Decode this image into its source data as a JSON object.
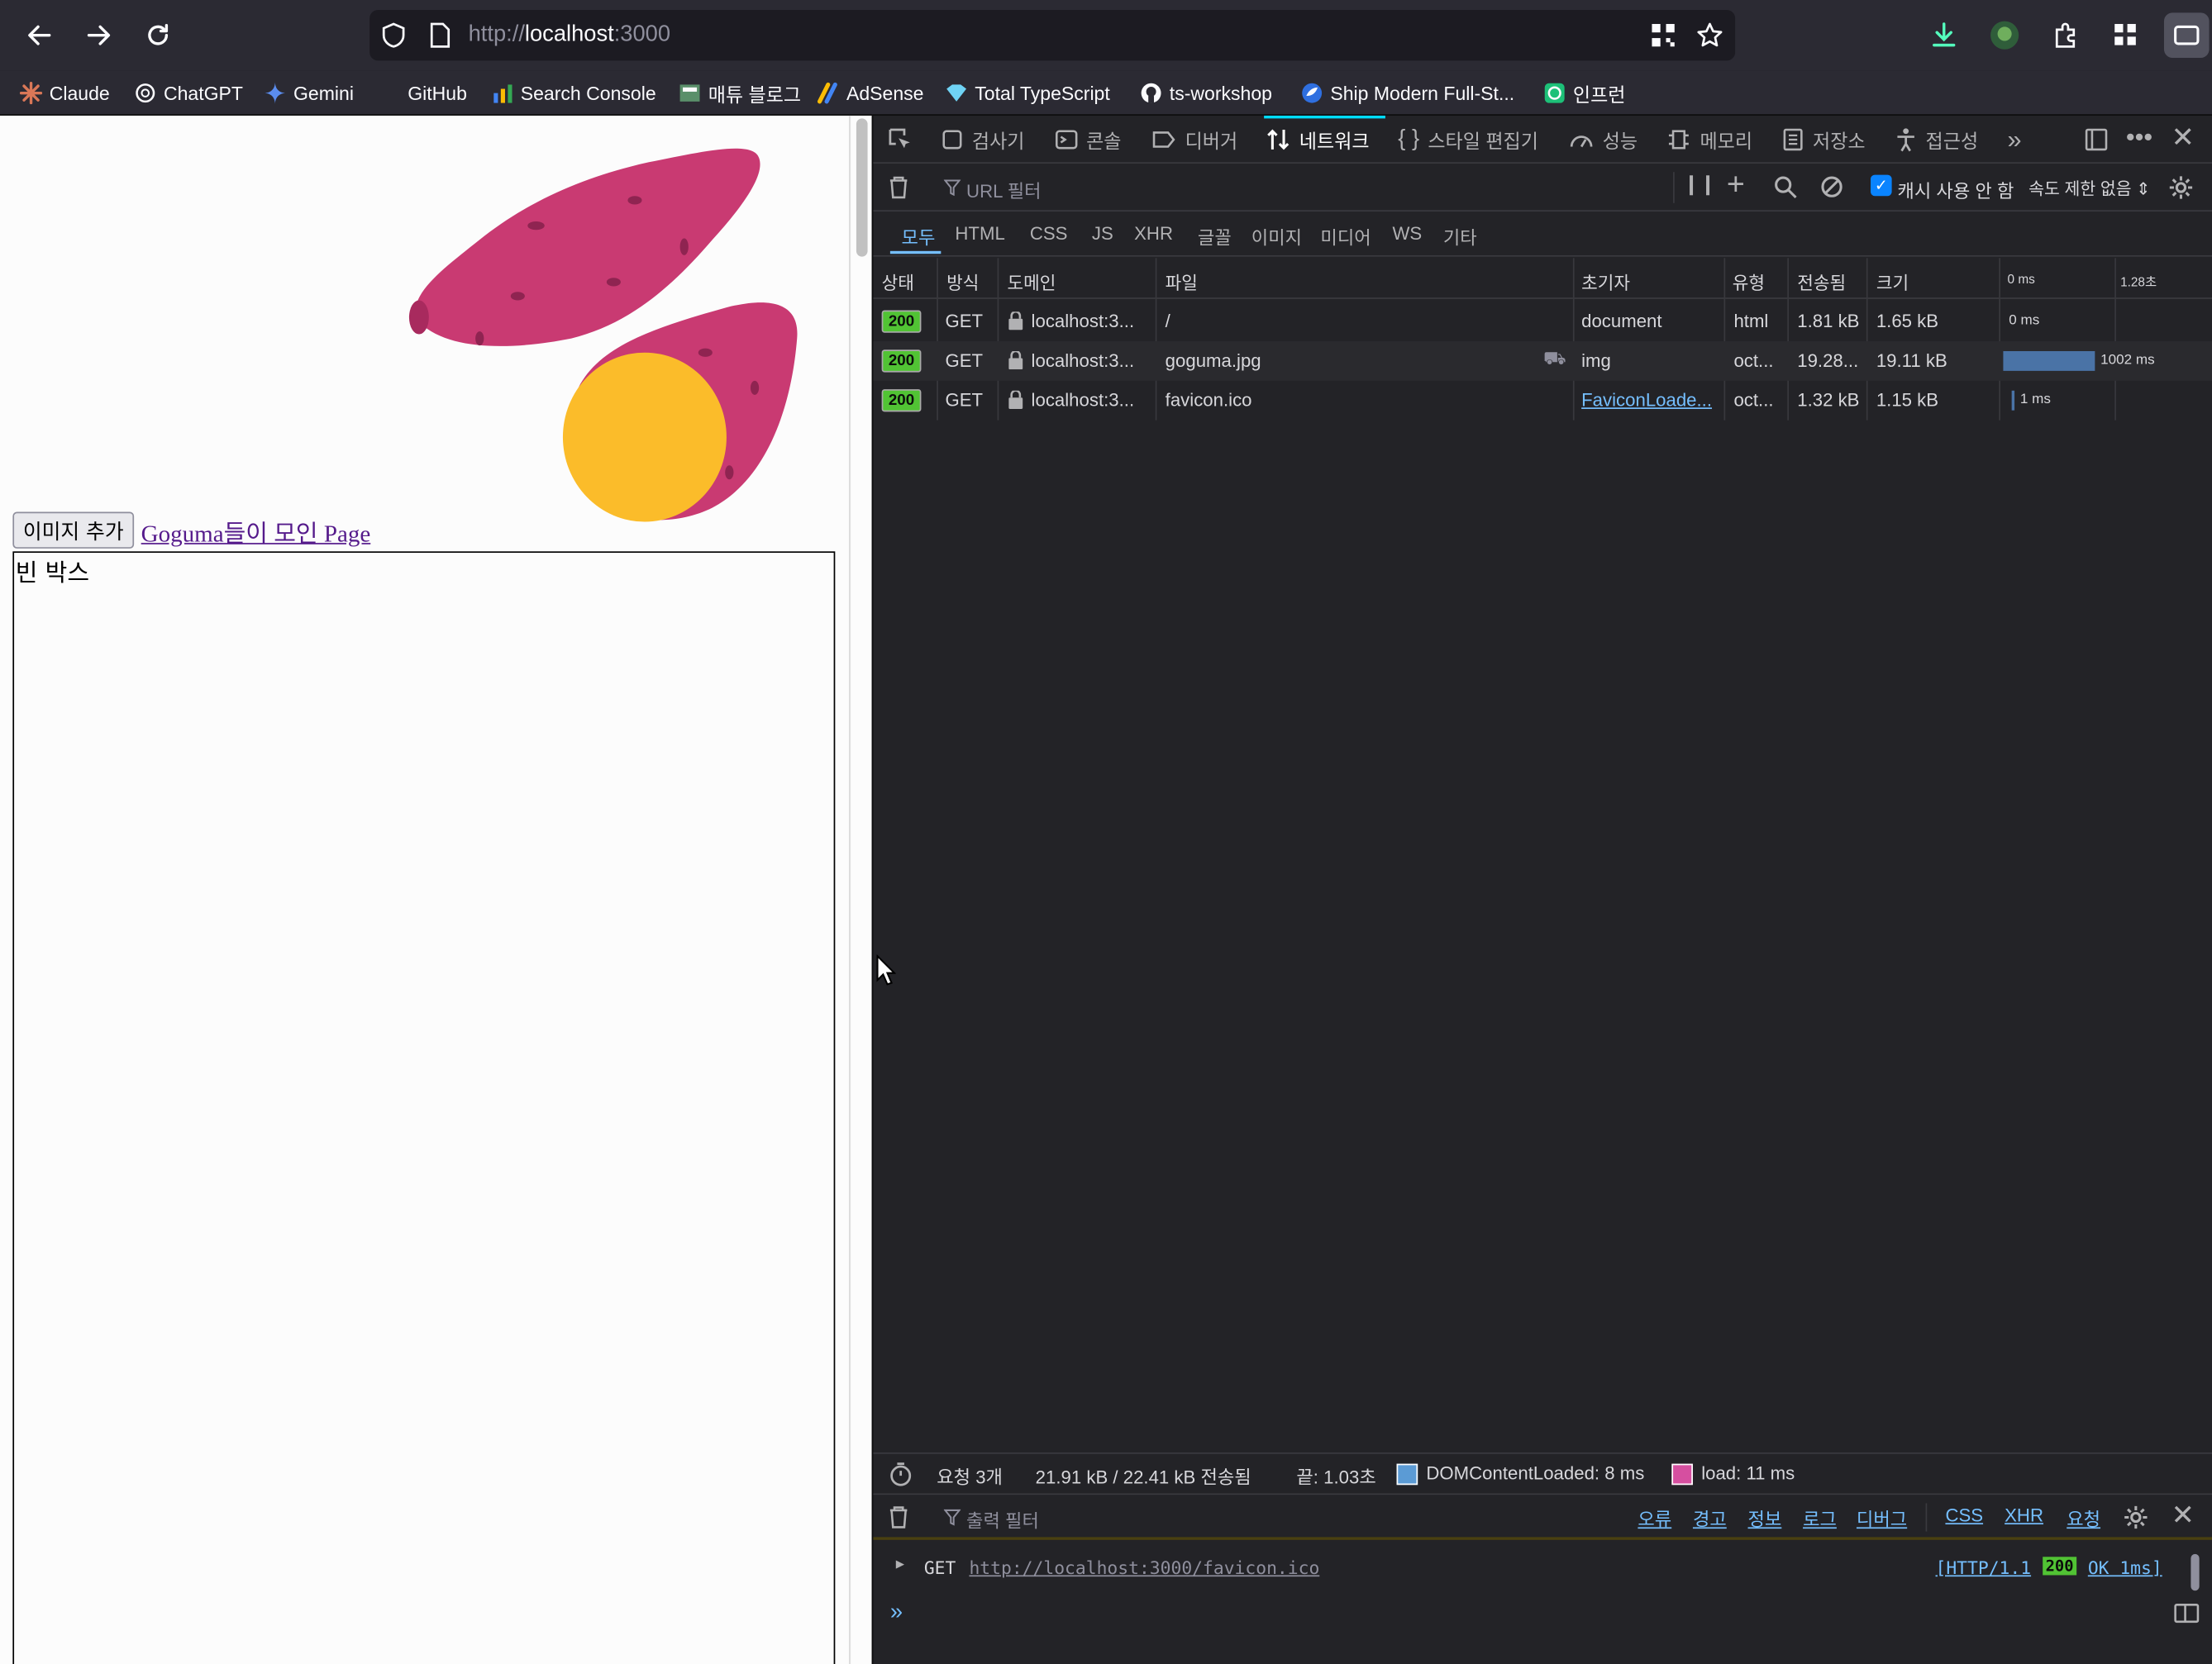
{
  "browser": {
    "url_scheme": "http://",
    "url_host": "localhost",
    "url_port": ":3000",
    "bookmarks": [
      {
        "label": "Claude",
        "icon": "claude-icon"
      },
      {
        "label": "ChatGPT",
        "icon": "chatgpt-icon"
      },
      {
        "label": "Gemini",
        "icon": "gemini-icon"
      },
      {
        "label": "GitHub",
        "icon": "github-icon"
      },
      {
        "label": "Search Console",
        "icon": "search-console-icon"
      },
      {
        "label": "매튜 블로그",
        "icon": "blog-icon"
      },
      {
        "label": "AdSense",
        "icon": "adsense-icon"
      },
      {
        "label": "Total TypeScript",
        "icon": "typescript-icon"
      },
      {
        "label": "ts-workshop",
        "icon": "github-icon"
      },
      {
        "label": "Ship Modern Full-St...",
        "icon": "ship-icon"
      },
      {
        "label": "인프런",
        "icon": "inflearn-icon"
      }
    ]
  },
  "page": {
    "add_image_button": "이미지 추가",
    "link_text": "Goguma들이 모인 Page",
    "empty_box_label": "빈 박스"
  },
  "devtools": {
    "tabs": [
      "검사기",
      "콘솔",
      "디버거",
      "네트워크",
      "스타일 편집기",
      "성능",
      "메모리",
      "저장소",
      "접근성"
    ],
    "active_tab": "네트워크",
    "filter_placeholder": "URL 필터",
    "disable_cache_label": "캐시 사용 안 함",
    "disable_cache_checked": true,
    "throttle_label": "속도 제한 없음",
    "type_filters": [
      "모두",
      "HTML",
      "CSS",
      "JS",
      "XHR",
      "글꼴",
      "이미지",
      "미디어",
      "WS",
      "기타"
    ],
    "active_type": "모두",
    "columns": [
      "상태",
      "방식",
      "도메인",
      "파일",
      "초기자",
      "유형",
      "전송됨",
      "크기"
    ],
    "timeline_ticks": [
      "0 ms",
      "1.28초"
    ],
    "requests": [
      {
        "status": "200",
        "method": "GET",
        "domain": "localhost:3...",
        "file": "/",
        "initiator": "document",
        "type": "html",
        "transferred": "1.81 kB",
        "size": "1.65 kB",
        "timing": "0 ms",
        "timing_fraction": 0.0
      },
      {
        "status": "200",
        "method": "GET",
        "domain": "localhost:3...",
        "file": "goguma.jpg",
        "initiator": "img",
        "type": "oct...",
        "transferred": "19.28...",
        "size": "19.11 kB",
        "timing": "1002 ms",
        "timing_fraction": 0.78
      },
      {
        "status": "200",
        "method": "GET",
        "domain": "localhost:3...",
        "file": "favicon.ico",
        "initiator": "FaviconLoade...",
        "type": "oct...",
        "transferred": "1.32 kB",
        "size": "1.15 kB",
        "timing": "1 ms",
        "timing_fraction": 0.01
      }
    ],
    "summary": {
      "requests": "요청 3개",
      "transferred": "21.91 kB / 22.41 kB 전송됨",
      "finish": "끝: 1.03초",
      "dcl": "DOMContentLoaded: 8 ms",
      "load": "load: 11 ms",
      "dcl_color": "#5b9bd5",
      "load_color": "#d64fa0"
    },
    "console": {
      "filter_placeholder": "출력 필터",
      "levels": [
        "오류",
        "경고",
        "정보",
        "로그",
        "디버그"
      ],
      "categories": [
        "CSS",
        "XHR",
        "요청"
      ],
      "log_method": "GET",
      "log_url": "http://localhost:3000/favicon.ico",
      "log_proto": "[HTTP/1.1",
      "log_status": "200",
      "log_status_text": "OK 1ms]"
    }
  },
  "colors": {
    "accent": "#00ddff",
    "status_ok": "#51c334",
    "link": "#551a8b",
    "sweet_potato": "#c93a72",
    "potato_flesh": "#fbbc2a"
  }
}
